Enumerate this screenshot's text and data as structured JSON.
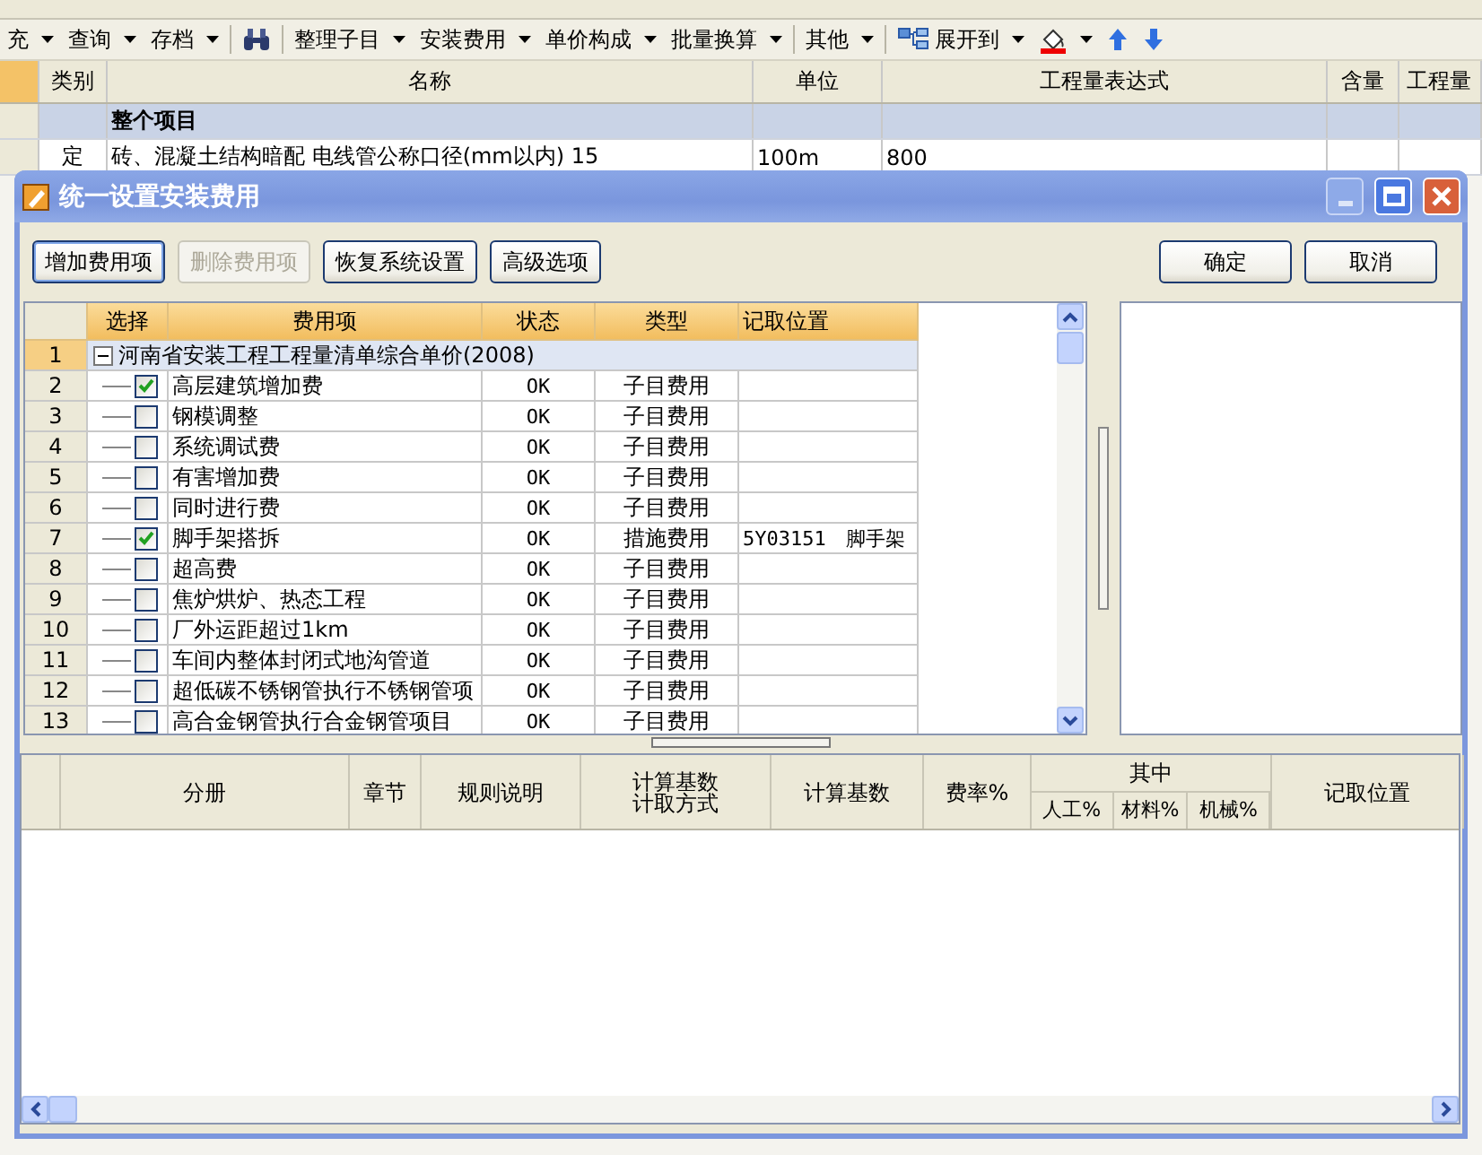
{
  "toolbar": {
    "items": [
      {
        "kind": "menu",
        "label": "充",
        "dropdown": true
      },
      {
        "kind": "menu",
        "label": "查询",
        "dropdown": true
      },
      {
        "kind": "menu",
        "label": "存档",
        "dropdown": true
      },
      {
        "kind": "binoculars",
        "dropdown": false
      },
      {
        "kind": "menu",
        "label": "整理子目",
        "dropdown": true
      },
      {
        "kind": "menu",
        "label": "安装费用",
        "dropdown": true
      },
      {
        "kind": "menu",
        "label": "单价构成",
        "dropdown": true
      },
      {
        "kind": "menu",
        "label": "批量换算",
        "dropdown": true
      },
      {
        "kind": "menu",
        "label": "其他",
        "dropdown": true
      },
      {
        "kind": "tree",
        "label": "展开到",
        "dropdown": true
      },
      {
        "kind": "fill",
        "dropdown": true
      },
      {
        "kind": "up",
        "dropdown": false
      },
      {
        "kind": "down",
        "dropdown": false
      }
    ]
  },
  "main_grid": {
    "columns": [
      "类别",
      "名称",
      "单位",
      "工程量表达式",
      "含量",
      "工程量"
    ],
    "rows": [
      {
        "kind": "group",
        "name": "整个项目"
      },
      {
        "kind": "item",
        "category": "定",
        "name": "砖、混凝土结构暗配 电线管公称口径(mm以内) 15",
        "unit": "100m",
        "expression": "800"
      }
    ]
  },
  "dialog": {
    "title": "统一设置安装费用",
    "buttons_left": [
      {
        "label": "增加费用项",
        "disabled": false
      },
      {
        "label": "删除费用项",
        "disabled": true
      },
      {
        "label": "恢复系统设置",
        "disabled": false
      },
      {
        "label": "高级选项",
        "disabled": false
      }
    ],
    "buttons_right": [
      "确定",
      "取消"
    ],
    "fee_table": {
      "columns": [
        "选择",
        "费用项",
        "状态",
        "类型",
        "记取位置"
      ],
      "group": {
        "number": "1",
        "label": "河南省安装工程工程量清单综合单价(2008)",
        "expanded": true
      },
      "items": [
        {
          "number": "2",
          "checked": true,
          "name": "高层建筑增加费",
          "status": "OK",
          "type": "子目费用"
        },
        {
          "number": "3",
          "checked": false,
          "name": "钢模调整",
          "status": "OK",
          "type": "子目费用"
        },
        {
          "number": "4",
          "checked": false,
          "name": "系统调试费",
          "status": "OK",
          "type": "子目费用"
        },
        {
          "number": "5",
          "checked": false,
          "name": "有害增加费",
          "status": "OK",
          "type": "子目费用"
        },
        {
          "number": "6",
          "checked": false,
          "name": "同时进行费",
          "status": "OK",
          "type": "子目费用"
        },
        {
          "number": "7",
          "checked": true,
          "name": "脚手架搭拆",
          "status": "OK",
          "type": "措施费用",
          "location": "5Y03151　脚手架"
        },
        {
          "number": "8",
          "checked": false,
          "name": "超高费",
          "status": "OK",
          "type": "子目费用"
        },
        {
          "number": "9",
          "checked": false,
          "name": "焦炉烘炉、热态工程",
          "status": "OK",
          "type": "子目费用"
        },
        {
          "number": "10",
          "checked": false,
          "name": "厂外运距超过1km",
          "status": "OK",
          "type": "子目费用"
        },
        {
          "number": "11",
          "checked": false,
          "name": "车间内整体封闭式地沟管道",
          "status": "OK",
          "type": "子目费用"
        },
        {
          "number": "12",
          "checked": false,
          "name": "超低碳不锈钢管执行不锈钢管项",
          "status": "OK",
          "type": "子目费用"
        },
        {
          "number": "13",
          "checked": false,
          "name": "高合金钢管执行合金钢管项目",
          "status": "OK",
          "type": "子目费用"
        }
      ]
    },
    "rule_table": {
      "columns": [
        {
          "label": "分册"
        },
        {
          "label": "章节"
        },
        {
          "label": "规则说明"
        },
        {
          "lines": [
            "计算基数",
            "计取方式"
          ]
        },
        {
          "label": "计算基数"
        },
        {
          "label": "费率%"
        },
        {
          "label": "其中",
          "children": [
            "人工%",
            "材料%",
            "机械%"
          ]
        },
        {
          "label": "记取位置"
        }
      ]
    }
  }
}
